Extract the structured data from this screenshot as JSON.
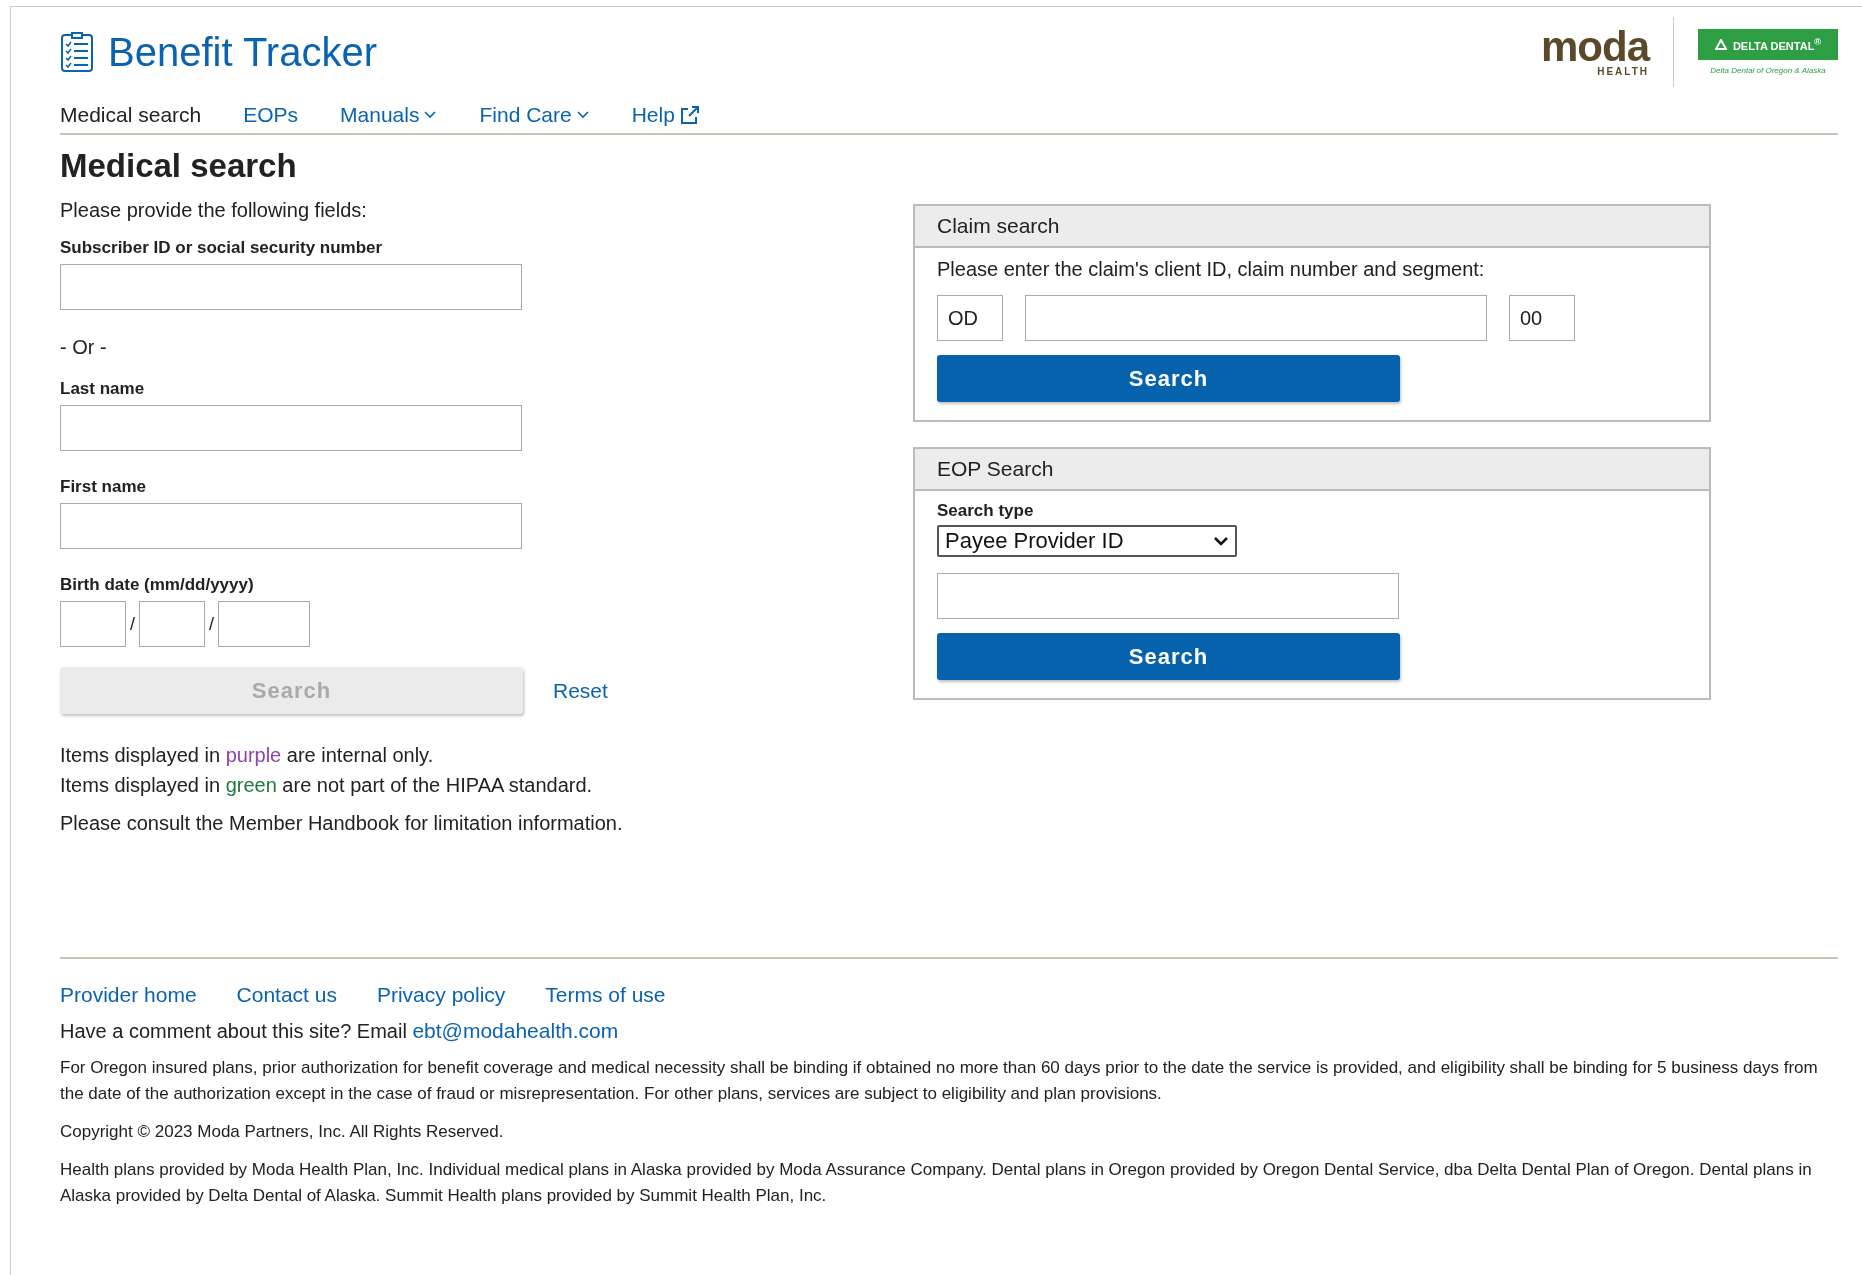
{
  "header": {
    "title": "Benefit Tracker",
    "moda_logo": {
      "name": "moda",
      "sub": "HEALTH"
    },
    "delta_logo": {
      "name": "DELTA DENTAL$^{®}$",
      "tagline": "Delta Dental of Oregon & Alaska"
    }
  },
  "nav": [
    {
      "label": "Medical search",
      "selected": true,
      "kind": "link"
    },
    {
      "label": "EOPs",
      "selected": false,
      "kind": "link"
    },
    {
      "label": "Manuals",
      "selected": false,
      "kind": "dropdown"
    },
    {
      "label": "Find Care",
      "selected": false,
      "kind": "dropdown"
    },
    {
      "label": "Help",
      "selected": false,
      "kind": "external"
    }
  ],
  "heading": "Medical search",
  "medical_form": {
    "intro": "Please provide the following fields:",
    "subscriber_label": "Subscriber ID or social security number",
    "or_text": "- Or -",
    "last_name_label": "Last name",
    "first_name_label": "First name",
    "birth_label": "Birth date (mm/dd/yyyy)",
    "date_separators": [
      "/",
      "/"
    ],
    "search_button": {
      "label": "Search",
      "disabled": true
    },
    "reset": "Reset"
  },
  "legend": [
    {
      "before": "Items displayed in ",
      "word": "purple",
      "after": " are internal only.",
      "color": "#8e44ad"
    },
    {
      "before": "Items displayed in ",
      "word": "green",
      "after": " are not part of the HIPAA standard.",
      "color": "#1e7a3c"
    }
  ],
  "consult": "Please consult the Member Handbook for limitation information.",
  "claim_search": {
    "title": "Claim search",
    "instruction": "Please enter the claim's client ID, claim number and segment:",
    "client_id": "OD",
    "segment": "00",
    "button": {
      "label": "Search",
      "disabled": false
    }
  },
  "eop_search": {
    "title": "EOP Search",
    "search_type_label": "Search type",
    "search_type_value": "Payee Provider ID",
    "button": {
      "label": "Search",
      "disabled": false
    }
  },
  "footer": {
    "links": [
      "Provider home",
      "Contact us",
      "Privacy policy",
      "Terms of use"
    ],
    "comment": {
      "text": "Have a comment about this site? Email",
      "email": "ebt@modahealth.com"
    },
    "disclaimer": "For Oregon insured plans, prior authorization for benefit coverage and medical necessity shall be binding if obtained no more than 60 days prior to the date the service is provided, and eligibility shall be binding for 5 business days from the date of the authorization except in the case of fraud or misrepresentation. For other plans, services are subject to eligibility and plan provisions.",
    "copyright": "Copyright © 2023 Moda Partners, Inc. All Rights Reserved.",
    "providers": "Health plans provided by Moda Health Plan, Inc. Individual medical plans in Alaska provided by Moda Assurance Company. Dental plans in Oregon provided by Oregon Dental Service, dba Delta Dental Plan of Oregon. Dental plans in Alaska provided by Delta Dental of Alaska. Summit Health plans provided by Summit Health Plan, Inc."
  }
}
